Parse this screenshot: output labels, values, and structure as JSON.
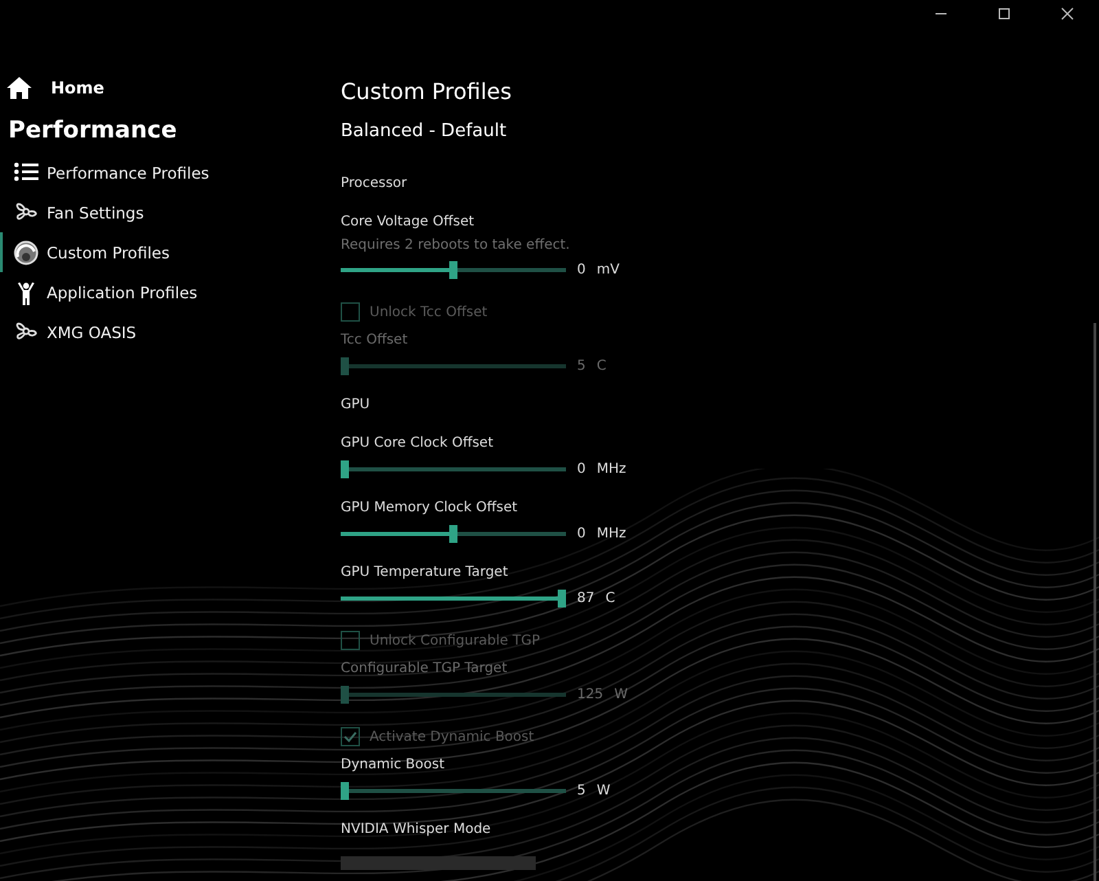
{
  "window": {
    "controls": [
      {
        "kind": "minimize"
      },
      {
        "kind": "maximize"
      },
      {
        "kind": "close"
      }
    ]
  },
  "sidebar": {
    "home": {
      "label": "Home"
    },
    "heading": "Performance",
    "items": [
      {
        "label": "Performance Profiles",
        "selected": false
      },
      {
        "label": "Fan Settings",
        "selected": false
      },
      {
        "label": "Custom Profiles",
        "selected": true
      },
      {
        "label": "Application Profiles",
        "selected": false
      },
      {
        "label": "XMG OASIS",
        "selected": false
      }
    ]
  },
  "page": {
    "title": "Custom Profiles",
    "subtitle": "Balanced - Default",
    "items": [
      {
        "kind": "section",
        "label": "Processor"
      },
      {
        "kind": "slider",
        "label": "Core Voltage Offset",
        "note": "Requires 2 reboots to take effect.",
        "level": 0.5,
        "value": "0",
        "unit": "mV",
        "disabled": false
      },
      {
        "kind": "checkbox",
        "label": "Unlock Tcc Offset",
        "checked": false,
        "disabled": true
      },
      {
        "kind": "slider",
        "label": "Tcc Offset",
        "level": 0.0,
        "value": "5",
        "unit": "C",
        "disabled": true
      },
      {
        "kind": "section",
        "label": "GPU"
      },
      {
        "kind": "slider",
        "label": "GPU Core Clock Offset",
        "level": 0.0,
        "value": "0",
        "unit": "MHz",
        "disabled": false
      },
      {
        "kind": "slider",
        "label": "GPU Memory Clock Offset",
        "level": 0.5,
        "value": "0",
        "unit": "MHz",
        "disabled": false
      },
      {
        "kind": "slider",
        "label": "GPU Temperature Target",
        "level": 1.0,
        "value": "87",
        "unit": "C",
        "disabled": false
      },
      {
        "kind": "checkbox",
        "label": "Unlock Configurable TGP",
        "checked": false,
        "disabled": true
      },
      {
        "kind": "slider",
        "label": "Configurable TGP Target",
        "level": 0.0,
        "value": "125",
        "unit": "W",
        "disabled": true
      },
      {
        "kind": "checkbox",
        "label": "Activate Dynamic Boost",
        "checked": true,
        "disabled": true
      },
      {
        "kind": "slider",
        "label": "Dynamic Boost",
        "level": 0.0,
        "value": "5",
        "unit": "W",
        "disabled": false
      },
      {
        "kind": "section",
        "label": "NVIDIA Whisper Mode"
      }
    ]
  }
}
